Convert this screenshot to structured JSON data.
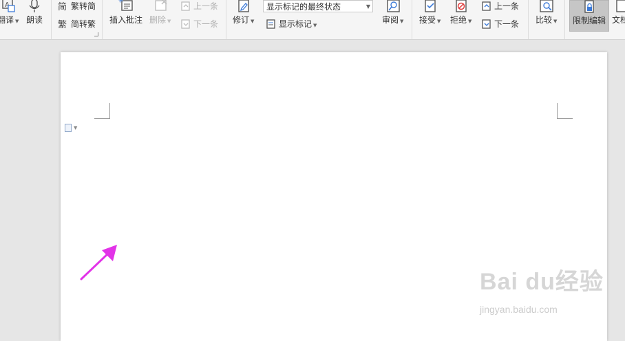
{
  "ribbon": {
    "translate_label": "翻译",
    "read_label": "朗读",
    "trad_to_simp_label": "繁转简",
    "simp_to_trad_label": "简转繁",
    "insert_comment_label": "插入批注",
    "delete_label": "删除",
    "prev_comment_label": "上一条",
    "next_comment_label": "下一条",
    "track_changes_label": "修订",
    "markup_state_value": "显示标记的最终状态",
    "show_markup_label": "显示标记",
    "review_label": "审阅",
    "accept_label": "接受",
    "reject_label": "拒绝",
    "prev_change_label": "上一条",
    "next_change_label": "下一条",
    "compare_label": "比较",
    "restrict_edit_label": "限制编辑",
    "document_label": "文档"
  },
  "colors": {
    "annotation_arrow": "#e233e8",
    "restrict_active_bg": "#c6c6c6",
    "accent_blue": "#3d7bd8",
    "reject_red": "#e03a3a"
  },
  "watermark": {
    "brand": "Bai  du经验",
    "url": "jingyan.baidu.com"
  }
}
